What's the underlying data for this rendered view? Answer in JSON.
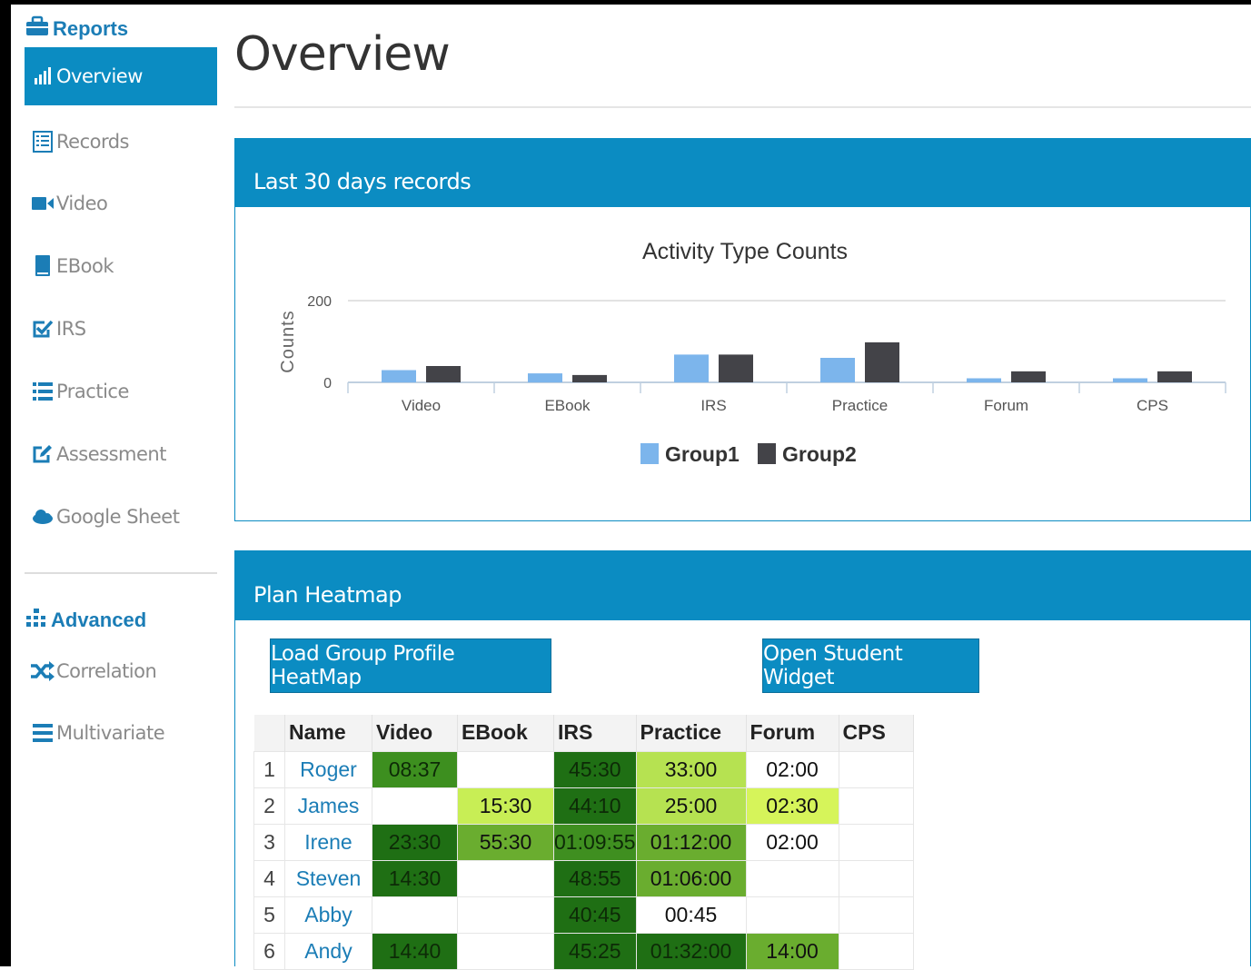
{
  "sidebar": {
    "reports_label": "Reports",
    "items": [
      {
        "label": "Overview",
        "icon": "bar-chart-icon",
        "active": true
      },
      {
        "label": "Records",
        "icon": "list-alt-icon"
      },
      {
        "label": "Video",
        "icon": "video-camera-icon"
      },
      {
        "label": "EBook",
        "icon": "book-icon"
      },
      {
        "label": "IRS",
        "icon": "check-square-icon"
      },
      {
        "label": "Practice",
        "icon": "list-icon"
      },
      {
        "label": "Assessment",
        "icon": "edit-icon"
      },
      {
        "label": "Google Sheet",
        "icon": "cloud-icon"
      }
    ],
    "advanced_label": "Advanced",
    "advanced_items": [
      {
        "label": "Correlation",
        "icon": "shuffle-icon"
      },
      {
        "label": "Multivariate",
        "icon": "bars-icon"
      }
    ]
  },
  "main": {
    "title": "Overview",
    "records_panel": {
      "title": "Last 30 days records"
    },
    "heatmap_panel": {
      "title": "Plan Heatmap",
      "load_button": "Load Group Profile HeatMap",
      "widget_button": "Open Student Widget"
    }
  },
  "chart_data": {
    "type": "bar",
    "title": "Activity Type Counts",
    "ylabel": "Counts",
    "ylim": [
      0,
      200
    ],
    "yticks": [
      "0",
      "200"
    ],
    "categories": [
      "Video",
      "EBook",
      "IRS",
      "Practice",
      "Forum",
      "CPS"
    ],
    "series": [
      {
        "name": "Group1",
        "values": [
          30,
          22,
          68,
          60,
          10,
          10
        ],
        "color": "#7cb5ec"
      },
      {
        "name": "Group2",
        "values": [
          40,
          18,
          68,
          98,
          27,
          27
        ],
        "color": "#434348"
      }
    ],
    "legend_position": "bottom-center",
    "grid": true
  },
  "heatmap": {
    "columns": [
      "Name",
      "Video",
      "EBook",
      "IRS",
      "Practice",
      "Forum",
      "CPS"
    ],
    "rows": [
      {
        "idx": "1",
        "name": "Roger",
        "cells": [
          "08:37",
          "",
          "45:30",
          "33:00",
          "02:00",
          ""
        ],
        "colors": [
          "#3d8f1f",
          "#ffffff",
          "#1f6f14",
          "#b6e251",
          "#ffffff",
          "#ffffff"
        ]
      },
      {
        "idx": "2",
        "name": "James",
        "cells": [
          "",
          "15:30",
          "44:10",
          "25:00",
          "02:30",
          ""
        ],
        "colors": [
          "#ffffff",
          "#c8ee55",
          "#1f6f14",
          "#b6e251",
          "#d6f45a",
          "#ffffff"
        ]
      },
      {
        "idx": "3",
        "name": "Irene",
        "cells": [
          "23:30",
          "55:30",
          "01:09:55",
          "01:12:00",
          "02:00",
          ""
        ],
        "colors": [
          "#1f6f14",
          "#6aad2f",
          "#3f8f20",
          "#6aad2f",
          "#ffffff",
          "#ffffff"
        ]
      },
      {
        "idx": "4",
        "name": "Steven",
        "cells": [
          "14:30",
          "",
          "48:55",
          "01:06:00",
          "",
          ""
        ],
        "colors": [
          "#1f6f14",
          "#ffffff",
          "#1f6f14",
          "#6aad2f",
          "#ffffff",
          "#ffffff"
        ]
      },
      {
        "idx": "5",
        "name": "Abby",
        "cells": [
          "",
          "",
          "40:45",
          "00:45",
          "",
          ""
        ],
        "colors": [
          "#ffffff",
          "#ffffff",
          "#1f6f14",
          "#ffffff",
          "#ffffff",
          "#ffffff"
        ]
      },
      {
        "idx": "6",
        "name": "Andy",
        "cells": [
          "14:40",
          "",
          "45:25",
          "01:32:00",
          "14:00",
          ""
        ],
        "colors": [
          "#1f6f14",
          "#ffffff",
          "#1f6f14",
          "#1f6f14",
          "#6aad2f",
          "#ffffff"
        ]
      }
    ]
  }
}
